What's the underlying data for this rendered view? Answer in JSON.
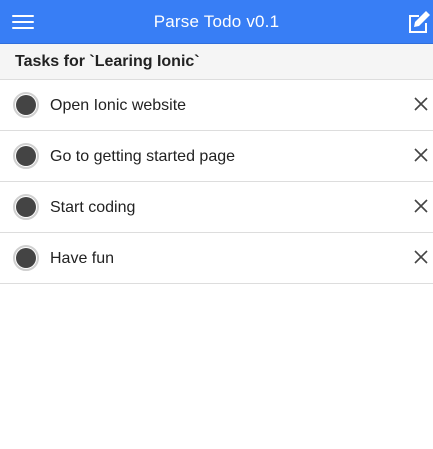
{
  "header": {
    "title": "Parse Todo v0.1",
    "menu_icon": "hamburger-menu-icon",
    "compose_icon": "compose-icon",
    "bg_color": "#387ef5"
  },
  "list": {
    "title": "Tasks for `Learing Ionic`",
    "items": [
      {
        "label": "Open Ionic website"
      },
      {
        "label": "Go to getting started page"
      },
      {
        "label": "Start coding"
      },
      {
        "label": "Have fun"
      }
    ],
    "delete_icon": "close-icon"
  }
}
